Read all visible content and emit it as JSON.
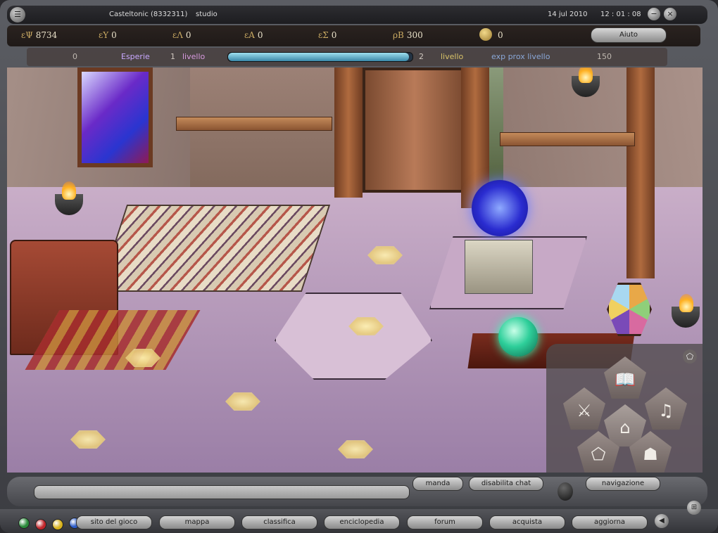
{
  "titlebar": {
    "menu_icon": "menu-icon",
    "player": "Casteltonic (8332311)",
    "location": "studio",
    "date": "14 jul 2010",
    "time": "12 : 01 : 08",
    "minimize_glyph": "−",
    "close_glyph": "×"
  },
  "stats": {
    "psi": {
      "symbol": "εΨ",
      "value": "8734"
    },
    "upsilon": {
      "symbol": "εΥ",
      "value": "0"
    },
    "lambda": {
      "symbol": "εΛ",
      "value": "0"
    },
    "alpha": {
      "symbol": "εΑ",
      "value": "0"
    },
    "sigma": {
      "symbol": "εΣ",
      "value": "0"
    },
    "beta": {
      "symbol": "ρΒ",
      "value": "300"
    },
    "coins": "0",
    "help_label": "Aiuto"
  },
  "experience": {
    "current_exp": "0",
    "exp_label": "Esperie",
    "level_current": "1",
    "level_label": "livello",
    "progress": 0.98,
    "level_next": "2",
    "level_next_label": "livello",
    "next_label": "exp prox livello",
    "next_value": "150"
  },
  "nav_panel": {
    "icons": [
      "book-icon",
      "sword-icon",
      "house-icon",
      "lyre-icon",
      "pentagon-icon",
      "warrior-head-icon"
    ],
    "book": "📖",
    "sword": "⚔",
    "house": "⌂",
    "lyre": "♫",
    "pentagon": "⬠",
    "warrior": "☗",
    "corner": "⬠"
  },
  "chat": {
    "input_value": "",
    "send_label": "manda",
    "disable_chat_label": "disabilita chat",
    "navigation_label": "navigazione"
  },
  "bottom": {
    "dots": [
      "#2a8a3a",
      "#c0252a",
      "#d8b21c",
      "#2c5bc8"
    ],
    "buttons": [
      "sito del gioco",
      "mappa",
      "classifica",
      "enciclopedia",
      "forum",
      "acquista",
      "aggiorna"
    ],
    "play_glyph": "◀",
    "grid_glyph": "⊞"
  }
}
